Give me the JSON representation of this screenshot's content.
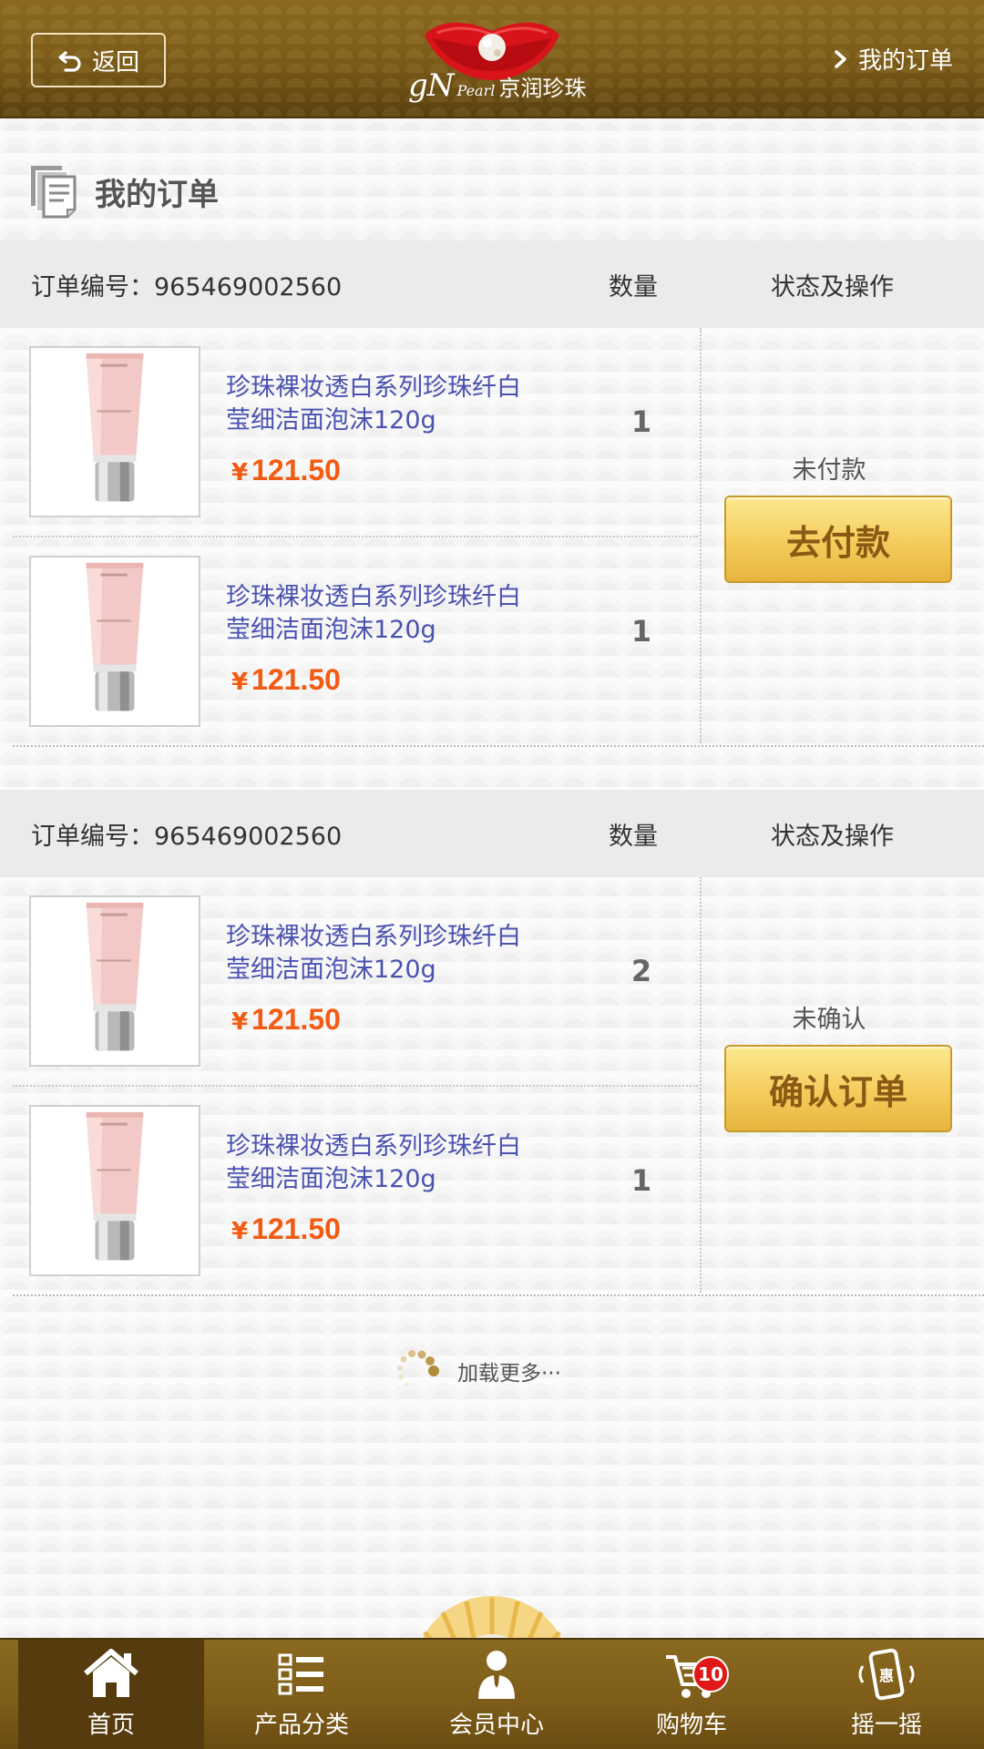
{
  "header": {
    "back_label": "返回",
    "logo_gn": "gN",
    "logo_pearl": "Pearl",
    "logo_cn": "京润珍珠",
    "right_link": "我的订单"
  },
  "page_title": "我的订单",
  "orders": [
    {
      "number_label": "订单编号：",
      "number": "965469002560",
      "qty_header": "数量",
      "status_header": "状态及操作",
      "items": [
        {
          "name": "珍珠裸妆透白系列珍珠纤白莹细洁面泡沫120g",
          "currency": "¥",
          "price": "121.50",
          "qty": "1"
        },
        {
          "name": "珍珠裸妆透白系列珍珠纤白莹细洁面泡沫120g",
          "currency": "¥",
          "price": "121.50",
          "qty": "1"
        }
      ],
      "status": "未付款",
      "action": "去付款"
    },
    {
      "number_label": "订单编号：",
      "number": "965469002560",
      "qty_header": "数量",
      "status_header": "状态及操作",
      "items": [
        {
          "name": "珍珠裸妆透白系列珍珠纤白莹细洁面泡沫120g",
          "currency": "¥",
          "price": "121.50",
          "qty": "2"
        },
        {
          "name": "珍珠裸妆透白系列珍珠纤白莹细洁面泡沫120g",
          "currency": "¥",
          "price": "121.50",
          "qty": "1"
        }
      ],
      "status": "未确认",
      "action": "确认订单"
    }
  ],
  "load_more": "加载更多···",
  "tabs": [
    {
      "label": "首页",
      "icon": "home-icon"
    },
    {
      "label": "产品分类",
      "icon": "category-list-icon"
    },
    {
      "label": "会员中心",
      "icon": "member-icon"
    },
    {
      "label": "购物车",
      "icon": "cart-icon",
      "badge": "10"
    },
    {
      "label": "摇一摇",
      "icon": "shake-phone-icon",
      "phone_text": "惠"
    }
  ],
  "colors": {
    "header_gold": "#7a5a18",
    "price_orange": "#f25b12",
    "product_link_blue": "#4a52b0",
    "button_gold": "#f4cc5c",
    "badge_red": "#e01818"
  }
}
